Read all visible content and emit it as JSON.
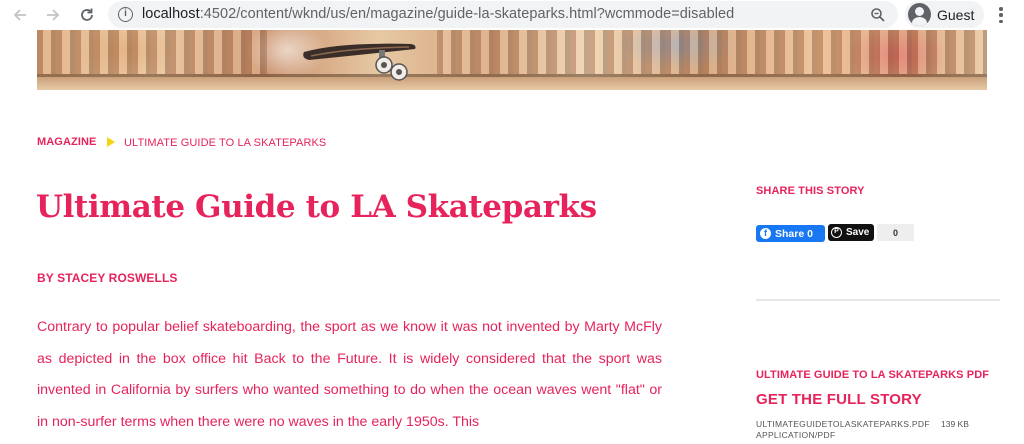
{
  "browser": {
    "url_host": "localhost",
    "url_rest": ":4502/content/wknd/us/en/magazine/guide-la-skateparks.html?wcmmode=disabled",
    "profile_label": "Guest"
  },
  "icons": {
    "back": "arrow-left-icon",
    "forward": "arrow-right-icon",
    "reload": "reload-icon",
    "info": "info-icon",
    "zoom": "magnifier-icon",
    "menu": "vertical-dots-icon",
    "facebook": "facebook-icon",
    "pinterest": "pinterest-icon"
  },
  "colors": {
    "accent": "#e6245b",
    "breadcrumb_arrow": "#f5d411",
    "facebook": "#1877f2"
  },
  "breadcrumb": {
    "parent": "MAGAZINE",
    "current": "ULTIMATE GUIDE TO LA SKATEPARKS"
  },
  "article": {
    "title": "Ultimate Guide to LA Skateparks",
    "byline": "BY STACEY ROSWELLS",
    "body": "Contrary to popular belief skateboarding, the sport as we know it was not invented by Marty McFly as depicted in the box office hit Back to the Future. It is widely considered that the sport was invented in California by surfers who wanted something to do when the ocean waves went \"flat\" or in non-surfer terms when there were no waves in the early 1950s. This"
  },
  "sidebar": {
    "share_heading": "SHARE THIS STORY",
    "fb_share_label": "Share 0",
    "pin_save_label": "Save",
    "pin_count": "0",
    "pdf_heading": "ULTIMATE GUIDE TO LA SKATEPARKS PDF",
    "get_story_label": "GET THE FULL STORY",
    "file_name": "ULTIMATEGUIDETOLASKATEPARKS.PDF",
    "file_size": "139 KB",
    "file_type": "APPLICATION/PDF"
  }
}
